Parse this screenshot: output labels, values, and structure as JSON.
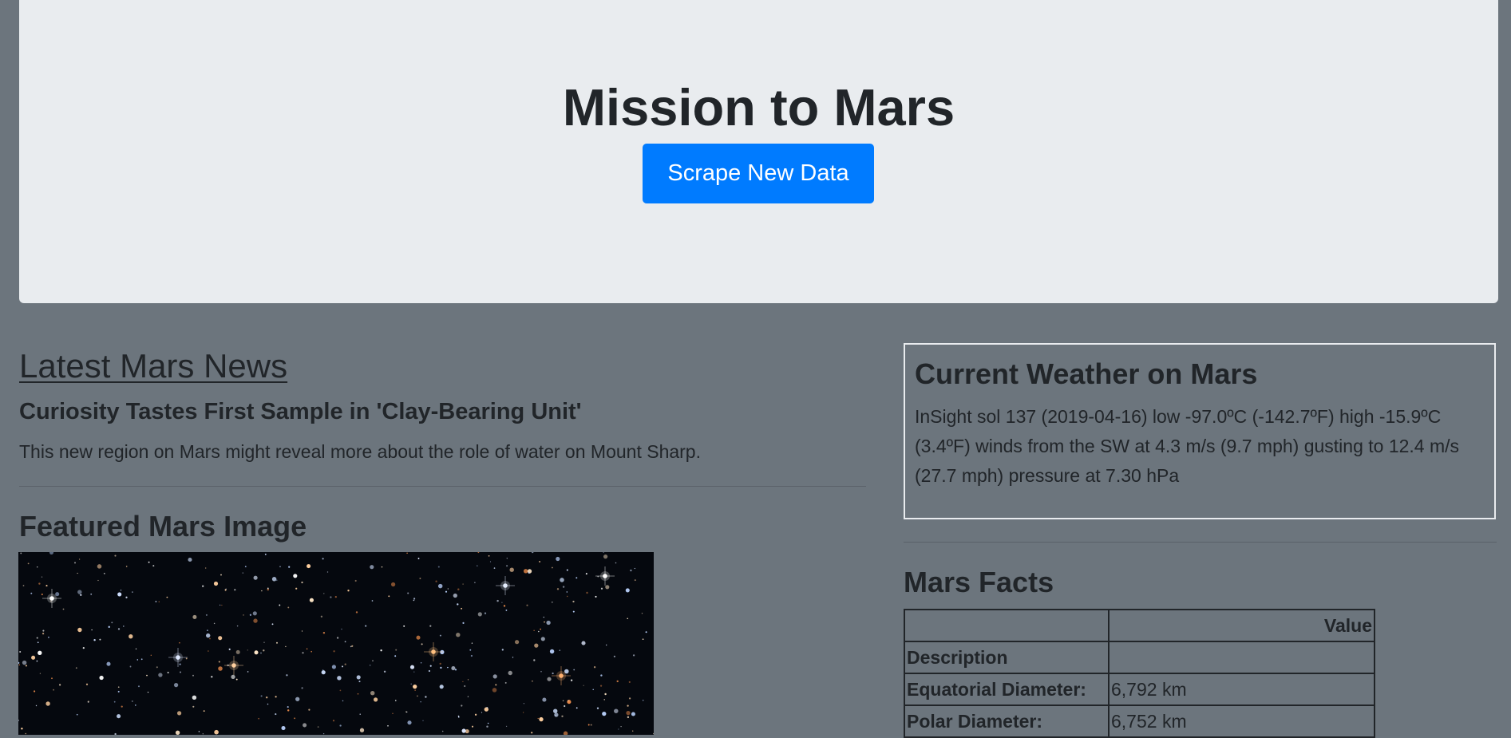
{
  "header": {
    "title": "Mission to Mars",
    "scrape_button_label": "Scrape New Data"
  },
  "news": {
    "heading": "Latest Mars News",
    "title": "Curiosity Tastes First Sample in 'Clay-Bearing Unit'",
    "teaser": "This new region on Mars might reveal more about the role of water on Mount Sharp."
  },
  "featured_image": {
    "heading": "Featured Mars Image",
    "subject": "star-field"
  },
  "weather": {
    "heading": "Current Weather on Mars",
    "text": "InSight sol 137 (2019-04-16) low -97.0ºC (-142.7ºF) high -15.9ºC (3.4ºF) winds from the SW at 4.3 m/s (9.7 mph) gusting to 12.4 m/s (27.7 mph) pressure at 7.30 hPa"
  },
  "facts": {
    "heading": "Mars Facts",
    "column_header_label": "",
    "column_header_value": "Value",
    "index_name": "Description",
    "rows": [
      {
        "label": "Equatorial Diameter:",
        "value": "6,792 km"
      },
      {
        "label": "Polar Diameter:",
        "value": "6,752 km"
      }
    ]
  },
  "colors": {
    "page_background": "#6c757d",
    "jumbotron_background": "#e9ecef",
    "button_primary": "#007bff",
    "text": "#212529"
  }
}
